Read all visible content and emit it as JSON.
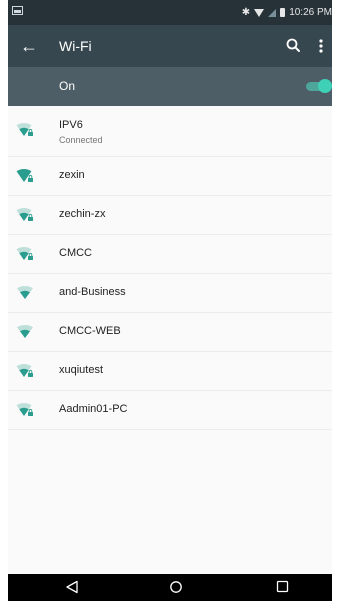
{
  "status_bar": {
    "time": "10:26 PM",
    "icons": [
      "screenshot-icon",
      "bluetooth-icon",
      "wifi-icon",
      "signal-icon",
      "battery-icon"
    ]
  },
  "toolbar": {
    "title": "Wi-Fi",
    "icons": [
      "back-arrow-icon",
      "search-icon",
      "overflow-menu-icon"
    ]
  },
  "wifi_switch": {
    "label": "On",
    "enabled": true
  },
  "networks": [
    {
      "name": "IPV6",
      "status": "Connected",
      "secured": true,
      "strength": 3
    },
    {
      "name": "zexin",
      "secured": true,
      "strength": 4
    },
    {
      "name": "zechin-zx",
      "secured": true,
      "strength": 3
    },
    {
      "name": "CMCC",
      "secured": true,
      "strength": 3
    },
    {
      "name": "and-Business",
      "secured": false,
      "strength": 3
    },
    {
      "name": "CMCC-WEB",
      "secured": false,
      "strength": 3
    },
    {
      "name": "xuqiutest",
      "secured": true,
      "strength": 3
    },
    {
      "name": "Aadmin01-PC",
      "secured": true,
      "strength": 3
    }
  ],
  "nav_bar": {
    "icons": [
      "nav-back-icon",
      "nav-home-icon",
      "nav-recents-icon"
    ]
  },
  "colors": {
    "status_bar": "#263238",
    "toolbar": "#37474f",
    "switch_bar": "#4d5e66",
    "accent": "#3fd0b8",
    "wifi_icon": "#2a9d8f"
  }
}
